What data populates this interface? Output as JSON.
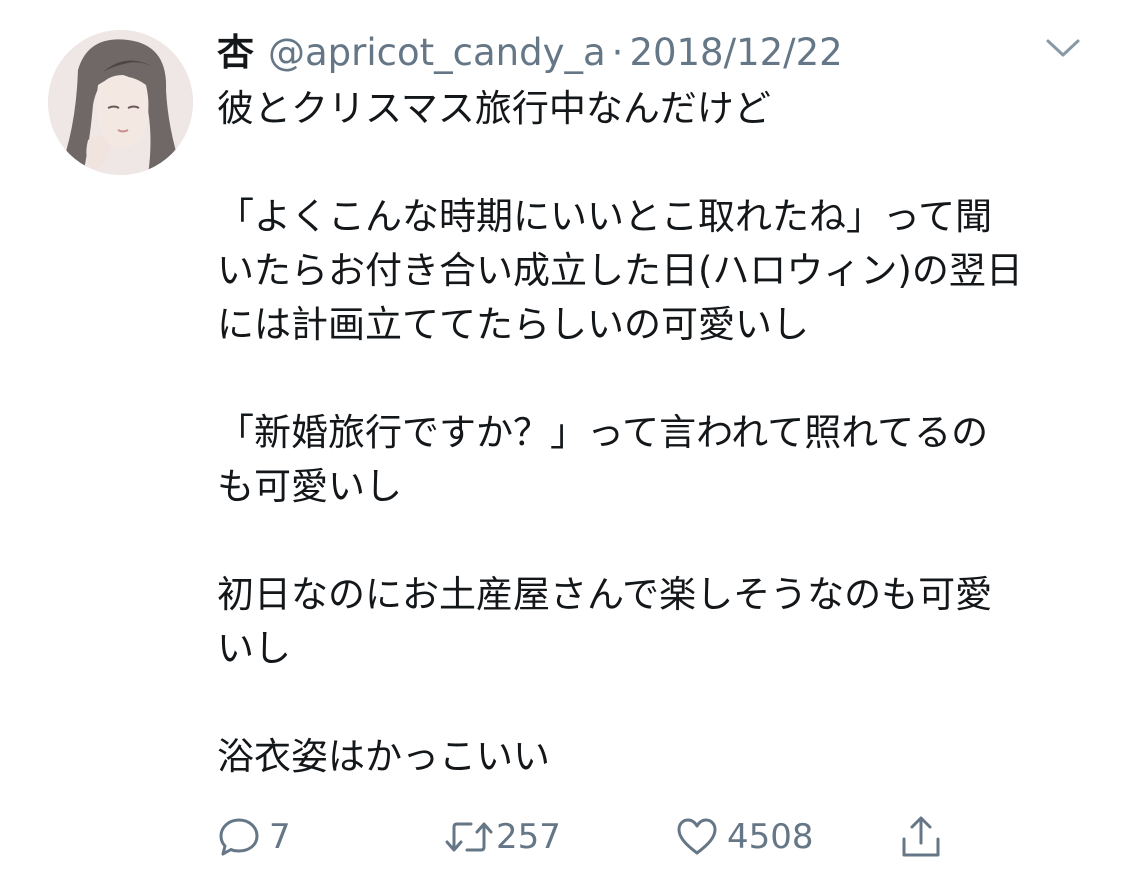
{
  "tweet": {
    "display_name": "杏",
    "handle": "@apricot_candy_a",
    "separator": "·",
    "date": "2018/12/22",
    "lines": [
      "彼とクリスマス旅行中なんだけど",
      "",
      "「よくこんな時期にいいとこ取れたね」って聞",
      "いたらお付き合い成立した日(ハロウィン)の翌日",
      "には計画立ててたらしいの可愛いし",
      "",
      "「新婚旅行ですか？」って言われて照れてるの",
      "も可愛いし",
      "",
      "初日なのにお土産屋さんで楽しそうなのも可愛",
      "いし",
      "",
      "浴衣姿はかっこいい"
    ],
    "actions": {
      "reply_count": "7",
      "retweet_count": "257",
      "like_count": "4508"
    },
    "icons": {
      "reply": "speech-bubble-icon",
      "retweet": "retweet-arrows-icon",
      "like": "heart-icon",
      "share": "share-upload-icon",
      "menu": "chevron-down-icon"
    },
    "colors": {
      "text": "#14171a",
      "secondary": "#657786"
    }
  }
}
